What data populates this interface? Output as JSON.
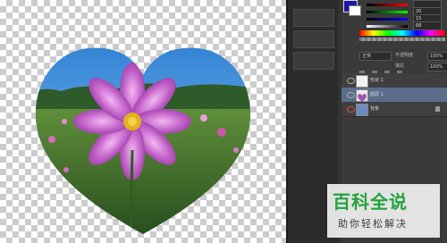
{
  "panel": {
    "color": {
      "fg": "#1a18a8",
      "bg": "#ffffff",
      "sliders": [
        {
          "channel": "r",
          "value": ""
        },
        {
          "channel": "g",
          "value": "20"
        },
        {
          "channel": "b",
          "value": "15"
        },
        {
          "channel": "k",
          "value": "68"
        }
      ]
    },
    "layers": {
      "mode": "正常",
      "opacity_label": "不透明度",
      "opacity": "100%",
      "fill_label": "填充",
      "fill": "100%",
      "items": [
        {
          "name": "形状 1",
          "selected": false
        },
        {
          "name": "图层 1",
          "selected": true
        },
        {
          "name": "背景",
          "selected": false
        }
      ]
    }
  },
  "watermark": {
    "title": "百科全说",
    "subtitle": "助你轻松解决"
  }
}
